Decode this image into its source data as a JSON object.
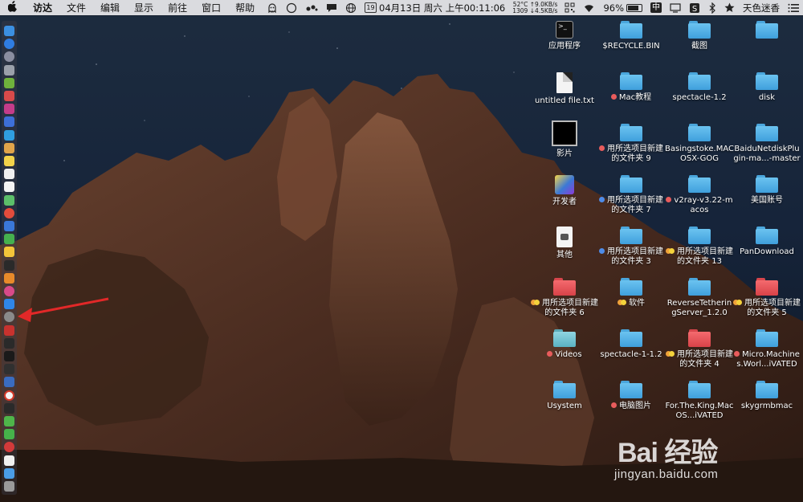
{
  "menubar": {
    "apple_icon": "apple-logo",
    "app_name": "访达",
    "menus": [
      "文件",
      "编辑",
      "显示",
      "前往",
      "窗口",
      "帮助"
    ],
    "net_speed": {
      "temp": "52°C",
      "up": "↑9.0KB/s",
      "rpm": "1309",
      "down": "↓4.5KB/s"
    },
    "date_icon_label": "19",
    "datetime": "04月13日 周六 上午00:11:06",
    "battery": "96%",
    "battery_level": 0.96,
    "ime": "中",
    "user": "天色迷香"
  },
  "desktop": {
    "icons": [
      {
        "label": "应用程序",
        "kind": "terminal"
      },
      {
        "label": "$RECYCLE.BIN",
        "kind": "folder-blue"
      },
      {
        "label": "截图",
        "kind": "folder-blue"
      },
      {
        "label": "",
        "kind": "folder-blue"
      },
      {
        "label": "untitled file.txt",
        "kind": "doc"
      },
      {
        "label": "Mac教程",
        "kind": "folder-blue",
        "tag": "red"
      },
      {
        "label": "spectacle-1.2",
        "kind": "folder-blue"
      },
      {
        "label": "disk",
        "kind": "folder-blue"
      },
      {
        "label": "影片",
        "kind": "movie"
      },
      {
        "label": "用所选项目新建的文件夹 9",
        "kind": "folder-blue",
        "tag": "red"
      },
      {
        "label": "Basingstoke.MACOSX-GOG",
        "kind": "folder-blue"
      },
      {
        "label": "BaiduNetdiskPlugin-ma...-master",
        "kind": "folder-blue"
      },
      {
        "label": "开发者",
        "kind": "dev"
      },
      {
        "label": "用所选项目新建的文件夹 7",
        "kind": "folder-blue",
        "tag": "blue"
      },
      {
        "label": "v2ray-v3.22-macos",
        "kind": "folder-blue",
        "tag": "red"
      },
      {
        "label": "美国账号",
        "kind": "folder-blue"
      },
      {
        "label": "其他",
        "kind": "other"
      },
      {
        "label": "用所选项目新建的文件夹 3",
        "kind": "folder-blue",
        "tag": "blue"
      },
      {
        "label": "用所选项目新建的文件夹 13",
        "kind": "folder-blue",
        "tag": "orange-yellow"
      },
      {
        "label": "PanDownload",
        "kind": "folder-blue"
      },
      {
        "label": "用所选项目新建的文件夹 6",
        "kind": "folder-red",
        "tag": "orange-yellow"
      },
      {
        "label": "软件",
        "kind": "folder-blue",
        "tag": "orange-yellow"
      },
      {
        "label": "ReverseTetheringServer_1.2.0",
        "kind": "folder-blue"
      },
      {
        "label": "用所选项目新建的文件夹 5",
        "kind": "folder-red",
        "tag": "orange-yellow"
      },
      {
        "label": "Videos",
        "kind": "folder-teal",
        "tag": "red"
      },
      {
        "label": "spectacle-1-1.2",
        "kind": "folder-blue"
      },
      {
        "label": "用所选项目新建的文件夹 4",
        "kind": "folder-red",
        "tag": "orange-yellow"
      },
      {
        "label": "Micro.Machines.Worl...iVATED",
        "kind": "folder-blue",
        "tag": "red"
      },
      {
        "label": "Usystem",
        "kind": "folder-blue"
      },
      {
        "label": "电脑图片",
        "kind": "folder-blue",
        "tag": "red"
      },
      {
        "label": "For.The.King.MacOS...iVATED",
        "kind": "folder-blue"
      },
      {
        "label": "skygrmbmac",
        "kind": "folder-blue"
      }
    ]
  },
  "dock": {
    "items": [
      "finder",
      "safari",
      "launchpad",
      "rocket",
      "android",
      "app-red",
      "app-pink",
      "app-blue",
      "xcode",
      "photos",
      "notes",
      "calendar",
      "reminders",
      "app-green",
      "chrome",
      "app-blue-2",
      "app-green-2",
      "app-yellow",
      "stocks",
      "app-orange",
      "itunes",
      "app-store",
      "system-preferences",
      "app-red-2",
      "app-dark",
      "terminal",
      "app-dark-2",
      "app-box",
      "yandex",
      "app-dark-3",
      "app-green-3",
      "wechat",
      "netease-music",
      "app-white",
      "finder-2",
      "trash"
    ]
  },
  "watermark": {
    "brand": "Bai  经验",
    "url": "jingyan.baidu.com"
  },
  "colors": {
    "folder_blue": "#5ab7ec",
    "folder_red": "#ee5a5f",
    "tag_red": "#e85c5c",
    "tag_blue": "#4e8ce8",
    "tag_orange": "#f0a23a",
    "tag_yellow": "#f4d23c",
    "arrow": "#e22828"
  }
}
